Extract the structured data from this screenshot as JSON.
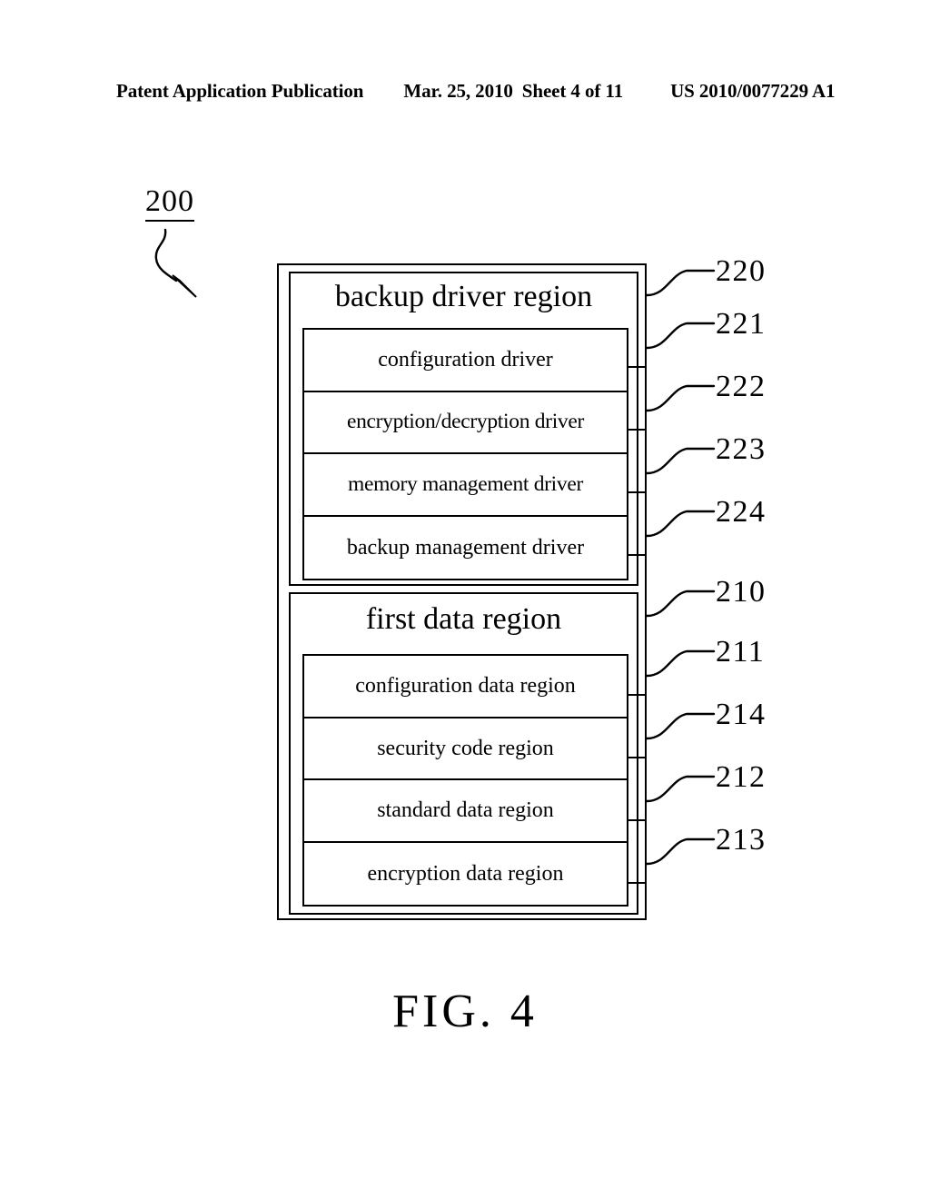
{
  "header": {
    "publication": "Patent Application Publication",
    "date": "Mar. 25, 2010",
    "sheet": "Sheet 4 of 11",
    "patent_number": "US 2010/0077229 A1"
  },
  "figure": {
    "caption": "FIG. 4",
    "system_ref": "200"
  },
  "regions": [
    {
      "title": "backup driver region",
      "ref": "220",
      "items": [
        {
          "label": "configuration driver",
          "ref": "221"
        },
        {
          "label": "encryption/decryption driver",
          "ref": "222"
        },
        {
          "label": "memory management driver",
          "ref": "223"
        },
        {
          "label": "backup management driver",
          "ref": "224"
        }
      ]
    },
    {
      "title": "first data region",
      "ref": "210",
      "items": [
        {
          "label": "configuration data region",
          "ref": "211"
        },
        {
          "label": "security code region",
          "ref": "214"
        },
        {
          "label": "standard data region",
          "ref": "212"
        },
        {
          "label": "encryption data region",
          "ref": "213"
        }
      ]
    }
  ],
  "colors": {
    "ink": "#000000",
    "paper": "#ffffff"
  }
}
